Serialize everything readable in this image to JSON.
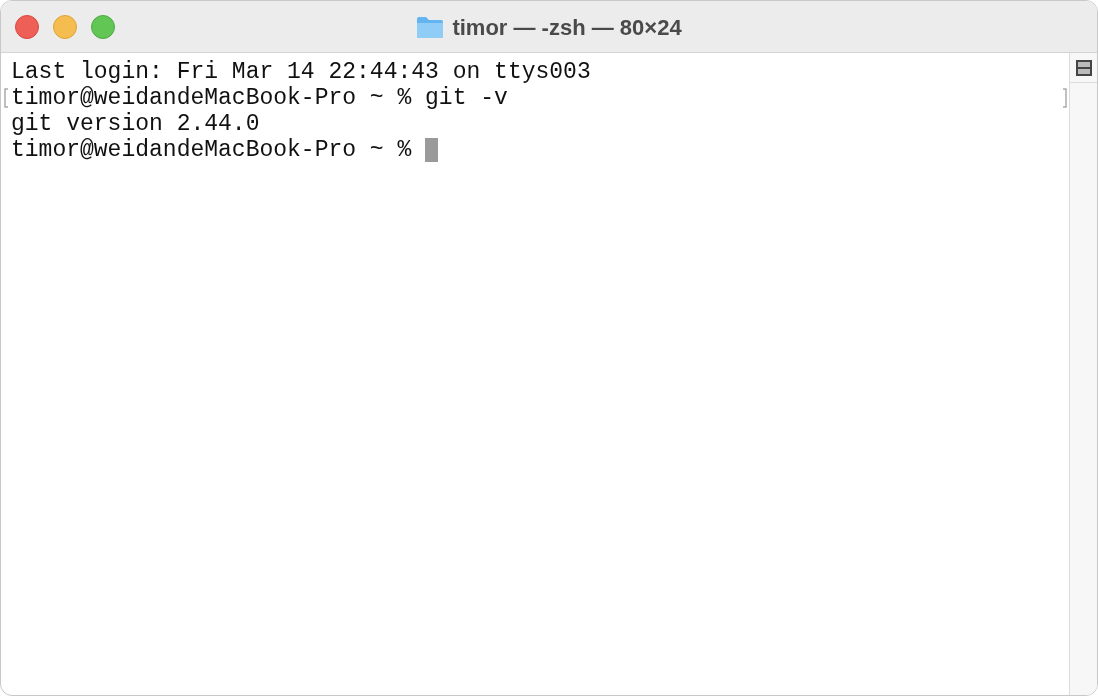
{
  "window": {
    "title": "timor — -zsh — 80×24"
  },
  "lines": [
    {
      "text": "Last login: Fri Mar 14 22:44:43 on ttys003",
      "marked": false,
      "cursor": false
    },
    {
      "text": "timor@weidandeMacBook-Pro ~ % git -v",
      "marked": true,
      "cursor": false
    },
    {
      "text": "git version 2.44.0",
      "marked": false,
      "cursor": false
    },
    {
      "text": "timor@weidandeMacBook-Pro ~ % ",
      "marked": false,
      "cursor": true
    }
  ]
}
